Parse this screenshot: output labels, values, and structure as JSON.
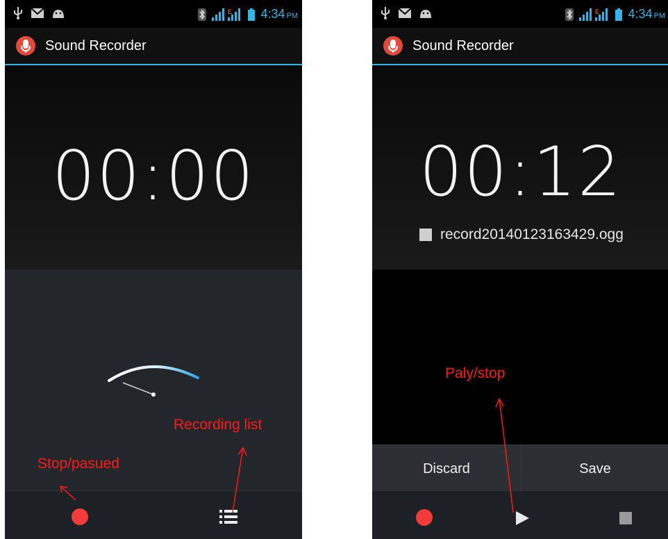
{
  "left_screen": {
    "status_bar": {
      "time": "4:34",
      "ampm": "PM"
    },
    "app_title": "Sound Recorder",
    "timer": "00:00",
    "annotations": {
      "stop_paused": "Stop/pasued",
      "recording_list": "Recording list"
    },
    "icons": [
      "usb-icon",
      "mail-icon",
      "android-icon",
      "bluetooth-icon",
      "signal-icon",
      "battery-icon",
      "mic-icon",
      "record-icon",
      "list-icon"
    ]
  },
  "right_screen": {
    "status_bar": {
      "time": "4:34",
      "ampm": "PM"
    },
    "app_title": "Sound Recorder",
    "timer": "00:12",
    "file_name": "record20140123163429.ogg",
    "discard_label": "Discard",
    "save_label": "Save",
    "annotations": {
      "play_stop": "Paly/stop"
    },
    "icons": [
      "record-icon",
      "play-icon",
      "stop-icon"
    ]
  },
  "colors": {
    "accent": "#33b5e5",
    "record": "#f23b3b",
    "annotation": "#ff1a1a"
  }
}
